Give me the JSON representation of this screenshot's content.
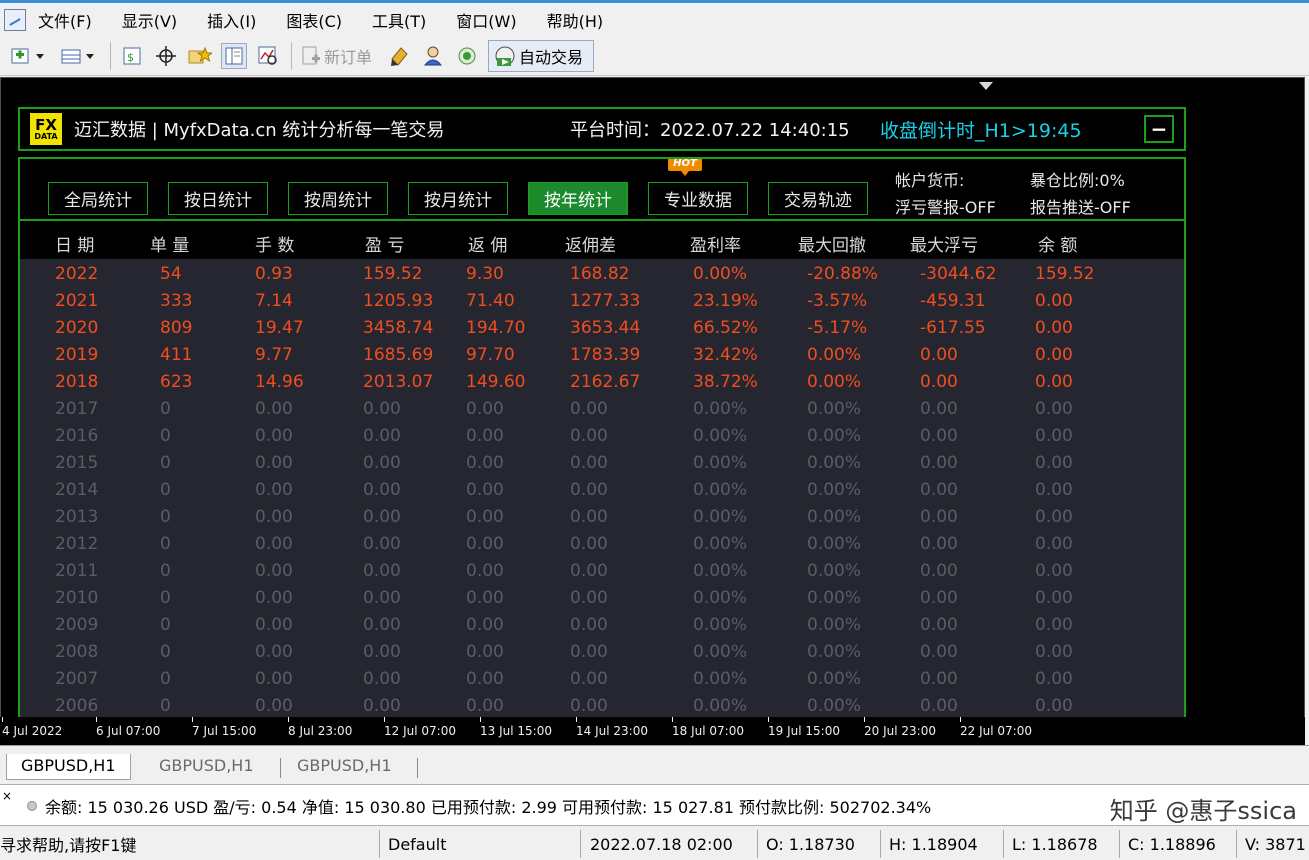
{
  "menu": [
    "文件(F)",
    "显示(V)",
    "插入(I)",
    "图表(C)",
    "工具(T)",
    "窗口(W)",
    "帮助(H)"
  ],
  "toolbar": {
    "new_order_label": "新订单",
    "auto_trade_label": "自动交易",
    "icons": [
      "new-chart-icon",
      "profiles-icon",
      "market-watch-icon",
      "crosshair-icon",
      "favorites-icon",
      "navigator-icon",
      "tester-icon",
      "new-order-icon",
      "metaeditor-icon",
      "experts-icon",
      "signals-icon",
      "auto-trading-icon"
    ]
  },
  "panel": {
    "logo_line1": "FX",
    "logo_line2": "DATA",
    "brand": "迈汇数据 | MyfxData.cn  统计分析每一笔交易",
    "platform_time": "平台时间：2022.07.22 14:40:15",
    "countdown": "收盘倒计时_H1>19:45",
    "minimize_label": "−",
    "tabs": [
      "全局统计",
      "按日统计",
      "按周统计",
      "按月统计",
      "按年统计",
      "专业数据",
      "交易轨迹"
    ],
    "active_tab": "按年统计",
    "hot_badge": "HOT",
    "account_currency": "帐户货币:",
    "float_alert": "浮亏警报-OFF",
    "exposure_ratio": "暴仓比例:0%",
    "report_push": "报告推送-OFF",
    "colors": {
      "accent_green": "#1ca01c",
      "active_row": "#f04e1e",
      "inactive_row": "#5c5c66",
      "countdown": "#18d0e8"
    }
  },
  "table": {
    "headers": [
      "日 期",
      "单 量",
      "手 数",
      "盈 亏",
      "返 佣",
      "返佣差",
      "盈利率",
      "最大回撤",
      "最大浮亏",
      "余 额"
    ],
    "rows": [
      {
        "active": true,
        "cells": [
          "2022",
          "54",
          "0.93",
          "159.52",
          "9.30",
          "168.82",
          "0.00%",
          "-20.88%",
          "-3044.62",
          "159.52"
        ]
      },
      {
        "active": true,
        "cells": [
          "2021",
          "333",
          "7.14",
          "1205.93",
          "71.40",
          "1277.33",
          "23.19%",
          "-3.57%",
          "-459.31",
          "0.00"
        ]
      },
      {
        "active": true,
        "cells": [
          "2020",
          "809",
          "19.47",
          "3458.74",
          "194.70",
          "3653.44",
          "66.52%",
          "-5.17%",
          "-617.55",
          "0.00"
        ]
      },
      {
        "active": true,
        "cells": [
          "2019",
          "411",
          "9.77",
          "1685.69",
          "97.70",
          "1783.39",
          "32.42%",
          "0.00%",
          "0.00",
          "0.00"
        ]
      },
      {
        "active": true,
        "cells": [
          "2018",
          "623",
          "14.96",
          "2013.07",
          "149.60",
          "2162.67",
          "38.72%",
          "0.00%",
          "0.00",
          "0.00"
        ]
      },
      {
        "active": false,
        "cells": [
          "2017",
          "0",
          "0.00",
          "0.00",
          "0.00",
          "0.00",
          "0.00%",
          "0.00%",
          "0.00",
          "0.00"
        ]
      },
      {
        "active": false,
        "cells": [
          "2016",
          "0",
          "0.00",
          "0.00",
          "0.00",
          "0.00",
          "0.00%",
          "0.00%",
          "0.00",
          "0.00"
        ]
      },
      {
        "active": false,
        "cells": [
          "2015",
          "0",
          "0.00",
          "0.00",
          "0.00",
          "0.00",
          "0.00%",
          "0.00%",
          "0.00",
          "0.00"
        ]
      },
      {
        "active": false,
        "cells": [
          "2014",
          "0",
          "0.00",
          "0.00",
          "0.00",
          "0.00",
          "0.00%",
          "0.00%",
          "0.00",
          "0.00"
        ]
      },
      {
        "active": false,
        "cells": [
          "2013",
          "0",
          "0.00",
          "0.00",
          "0.00",
          "0.00",
          "0.00%",
          "0.00%",
          "0.00",
          "0.00"
        ]
      },
      {
        "active": false,
        "cells": [
          "2012",
          "0",
          "0.00",
          "0.00",
          "0.00",
          "0.00",
          "0.00%",
          "0.00%",
          "0.00",
          "0.00"
        ]
      },
      {
        "active": false,
        "cells": [
          "2011",
          "0",
          "0.00",
          "0.00",
          "0.00",
          "0.00",
          "0.00%",
          "0.00%",
          "0.00",
          "0.00"
        ]
      },
      {
        "active": false,
        "cells": [
          "2010",
          "0",
          "0.00",
          "0.00",
          "0.00",
          "0.00",
          "0.00%",
          "0.00%",
          "0.00",
          "0.00"
        ]
      },
      {
        "active": false,
        "cells": [
          "2009",
          "0",
          "0.00",
          "0.00",
          "0.00",
          "0.00",
          "0.00%",
          "0.00%",
          "0.00",
          "0.00"
        ]
      },
      {
        "active": false,
        "cells": [
          "2008",
          "0",
          "0.00",
          "0.00",
          "0.00",
          "0.00",
          "0.00%",
          "0.00%",
          "0.00",
          "0.00"
        ]
      },
      {
        "active": false,
        "cells": [
          "2007",
          "0",
          "0.00",
          "0.00",
          "0.00",
          "0.00",
          "0.00%",
          "0.00%",
          "0.00",
          "0.00"
        ]
      },
      {
        "active": false,
        "cells": [
          "2006",
          "0",
          "0.00",
          "0.00",
          "0.00",
          "0.00",
          "0.00%",
          "0.00%",
          "0.00",
          "0.00"
        ]
      }
    ]
  },
  "time_axis": [
    "4 Jul 2022",
    "6 Jul 07:00",
    "7 Jul 15:00",
    "8 Jul 23:00",
    "12 Jul 07:00",
    "13 Jul 15:00",
    "14 Jul 23:00",
    "18 Jul 07:00",
    "19 Jul 15:00",
    "20 Jul 23:00",
    "22 Jul 07:00"
  ],
  "chart_tabs": [
    "GBPUSD,H1",
    "GBPUSD,H1",
    "GBPUSD,H1"
  ],
  "terminal": {
    "close_label": "×",
    "account_line": "余额: 15 030.26 USD  盈/亏: 0.54  净值: 15 030.80  已用预付款: 2.99  可用预付款: 15 027.81  预付款比例: 502702.34%",
    "watermark": "知乎 @惠子ssica"
  },
  "status": {
    "help": "寻求帮助,请按F1键",
    "profile": "Default",
    "datetime": "2022.07.18 02:00",
    "open": "O: 1.18730",
    "high": "H: 1.18904",
    "low": "L: 1.18678",
    "close": "C: 1.18896",
    "volume": "V: 3871"
  }
}
